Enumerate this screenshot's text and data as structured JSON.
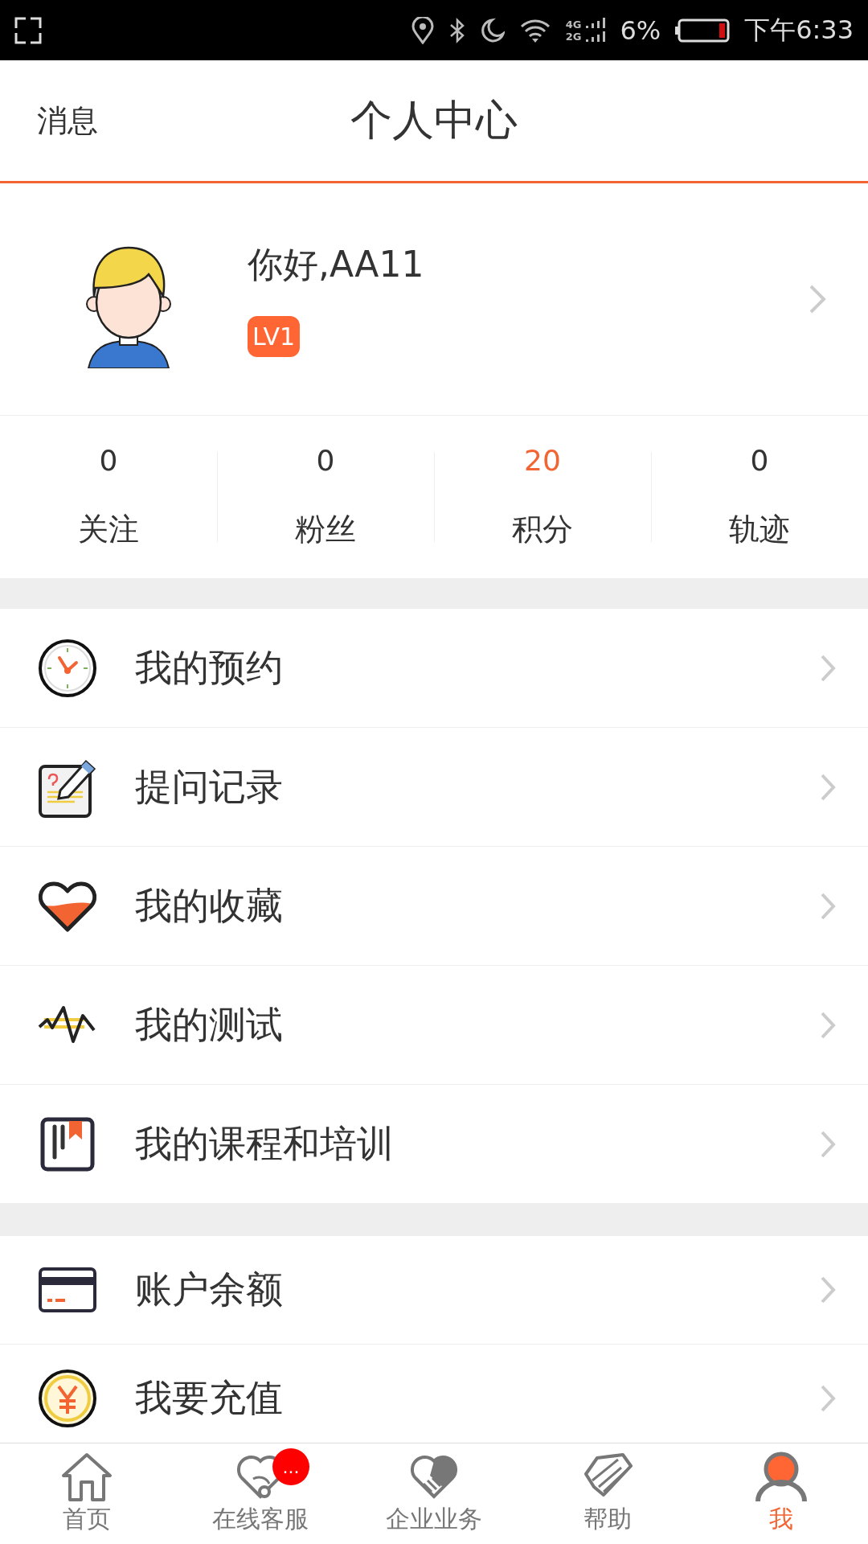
{
  "status_bar": {
    "network_top": "4G",
    "network_bottom": "2G",
    "battery": "6%",
    "time": "下午6:33"
  },
  "header": {
    "left": "消息",
    "title": "个人中心"
  },
  "profile": {
    "greeting": "你好,AA11",
    "level_badge": "LV1"
  },
  "stats": [
    {
      "value": "0",
      "label": "关注",
      "highlighted": false
    },
    {
      "value": "0",
      "label": "粉丝",
      "highlighted": false
    },
    {
      "value": "20",
      "label": "积分",
      "highlighted": true
    },
    {
      "value": "0",
      "label": "轨迹",
      "highlighted": false
    }
  ],
  "menu_groups": [
    [
      {
        "kind": "clock",
        "label": "我的预约"
      },
      {
        "kind": "note",
        "label": "提问记录"
      },
      {
        "kind": "heart",
        "label": "我的收藏"
      },
      {
        "kind": "wave",
        "label": "我的测试"
      },
      {
        "kind": "book",
        "label": "我的课程和培训"
      }
    ],
    [
      {
        "kind": "card",
        "label": "账户余额"
      },
      {
        "kind": "coin",
        "label": "我要充值"
      }
    ]
  ],
  "tab_bar": [
    {
      "kind": "home",
      "label": "首页",
      "selected": false
    },
    {
      "kind": "service",
      "label": "在线客服",
      "selected": false,
      "badge": "..."
    },
    {
      "kind": "handshake",
      "label": "企业业务",
      "selected": false
    },
    {
      "kind": "help",
      "label": "帮助",
      "selected": false
    },
    {
      "kind": "person",
      "label": "我",
      "selected": true
    }
  ]
}
